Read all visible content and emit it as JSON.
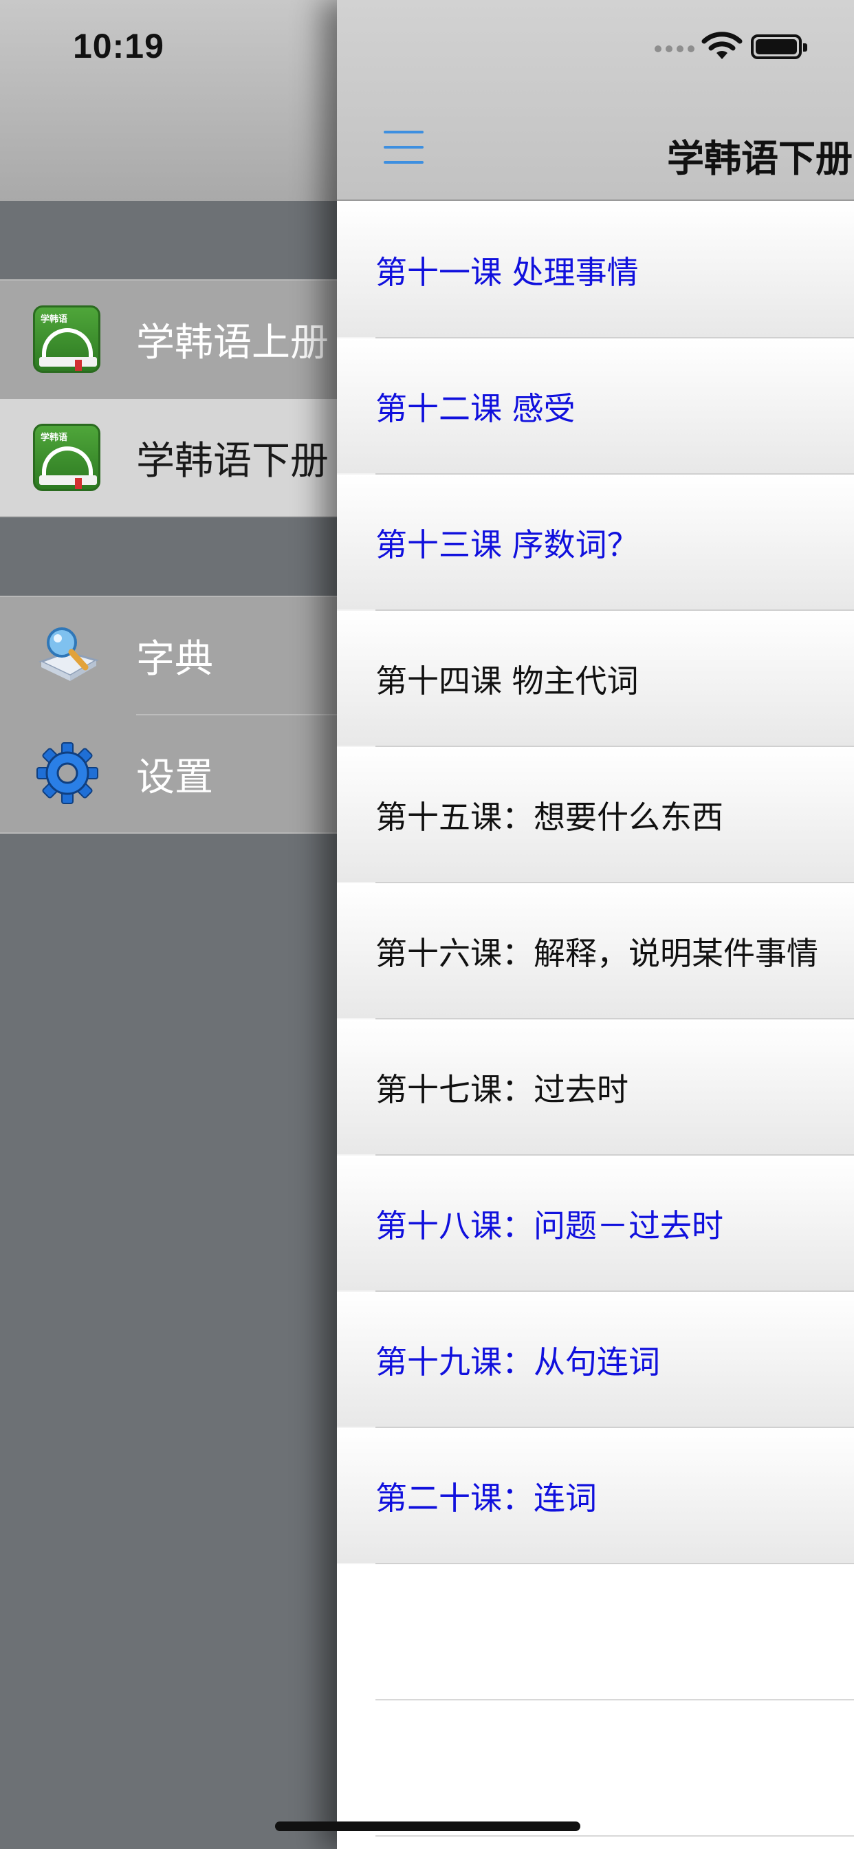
{
  "status_bar": {
    "time": "10:19"
  },
  "menu": {
    "books": [
      {
        "label": "学韩语上册",
        "icon": "app-book-icon",
        "selected": false
      },
      {
        "label": "学韩语下册",
        "icon": "app-book-icon",
        "selected": true
      }
    ],
    "tools": [
      {
        "label": "字典",
        "icon": "dictionary-icon"
      },
      {
        "label": "设置",
        "icon": "gear-icon"
      }
    ]
  },
  "main": {
    "title": "学韩语下册",
    "lessons": [
      {
        "label": "第十一课 处理事情",
        "color": "#1010dd"
      },
      {
        "label": "第十二课 感受",
        "color": "#1010dd"
      },
      {
        "label": "第十三课 序数词？",
        "color": "#1010dd"
      },
      {
        "label": "第十四课 物主代词",
        "color": "#111111"
      },
      {
        "label": "第十五课：想要什么东西",
        "color": "#111111"
      },
      {
        "label": "第十六课：解释，说明某件事情",
        "color": "#111111"
      },
      {
        "label": "第十七课：过去时",
        "color": "#111111"
      },
      {
        "label": "第十八课：问题－过去时",
        "color": "#1010dd"
      },
      {
        "label": "第十九课：从句连词",
        "color": "#1010dd"
      },
      {
        "label": "第二十课：连词",
        "color": "#1010dd"
      }
    ]
  },
  "colors": {
    "accent": "#3d8fe0",
    "lesson_highlight": "#1010dd",
    "menu_background": "#6d7175"
  }
}
